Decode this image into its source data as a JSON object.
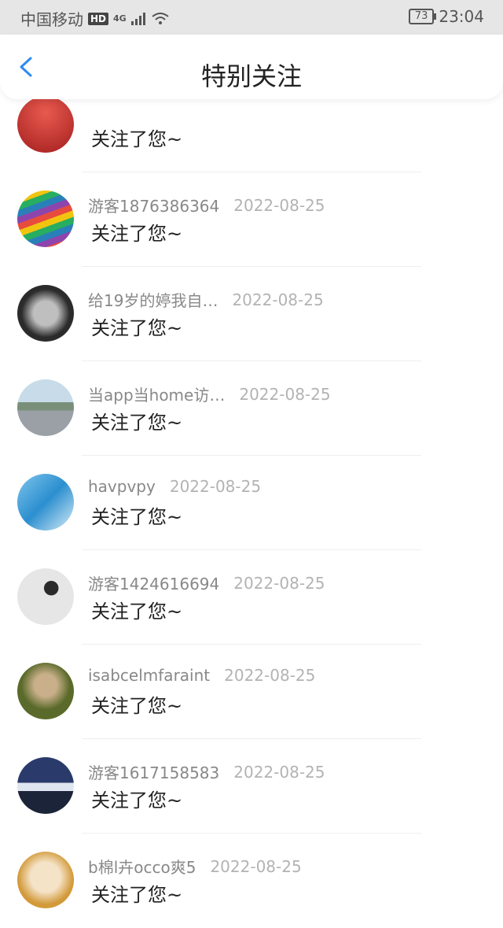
{
  "status_bar": {
    "carrier": "中国移动",
    "hd_badge": "HD",
    "network": "4G",
    "battery": "73",
    "time": "23:04"
  },
  "header": {
    "title": "特别关注"
  },
  "items": [
    {
      "name": "",
      "date": "",
      "message": "关注了您~",
      "avatar_color": "#c0392b"
    },
    {
      "name": "游客1876386364",
      "date": "2022-08-25",
      "message": "关注了您~",
      "avatar_color": "#d4a46b"
    },
    {
      "name": "给19岁的婷我自…",
      "date": "2022-08-25",
      "message": "关注了您~",
      "avatar_color": "#2c2c2c"
    },
    {
      "name": "当app当home访…",
      "date": "2022-08-25",
      "message": "关注了您~",
      "avatar_color": "#8fb3c9"
    },
    {
      "name": "havpvpy",
      "date": "2022-08-25",
      "message": "关注了您~",
      "avatar_color": "#4aa3d9"
    },
    {
      "name": "游客1424616694",
      "date": "2022-08-25",
      "message": "关注了您~",
      "avatar_color": "#cfcfcf"
    },
    {
      "name": "isabcelmfaraint",
      "date": "2022-08-25",
      "message": "关注了您~",
      "avatar_color": "#6f7d3a"
    },
    {
      "name": "游客1617158583",
      "date": "2022-08-25",
      "message": "关注了您~",
      "avatar_color": "#1e2a4a"
    },
    {
      "name": "b棉l卉occo爽5",
      "date": "2022-08-25",
      "message": "关注了您~",
      "avatar_color": "#d9a34a"
    }
  ]
}
